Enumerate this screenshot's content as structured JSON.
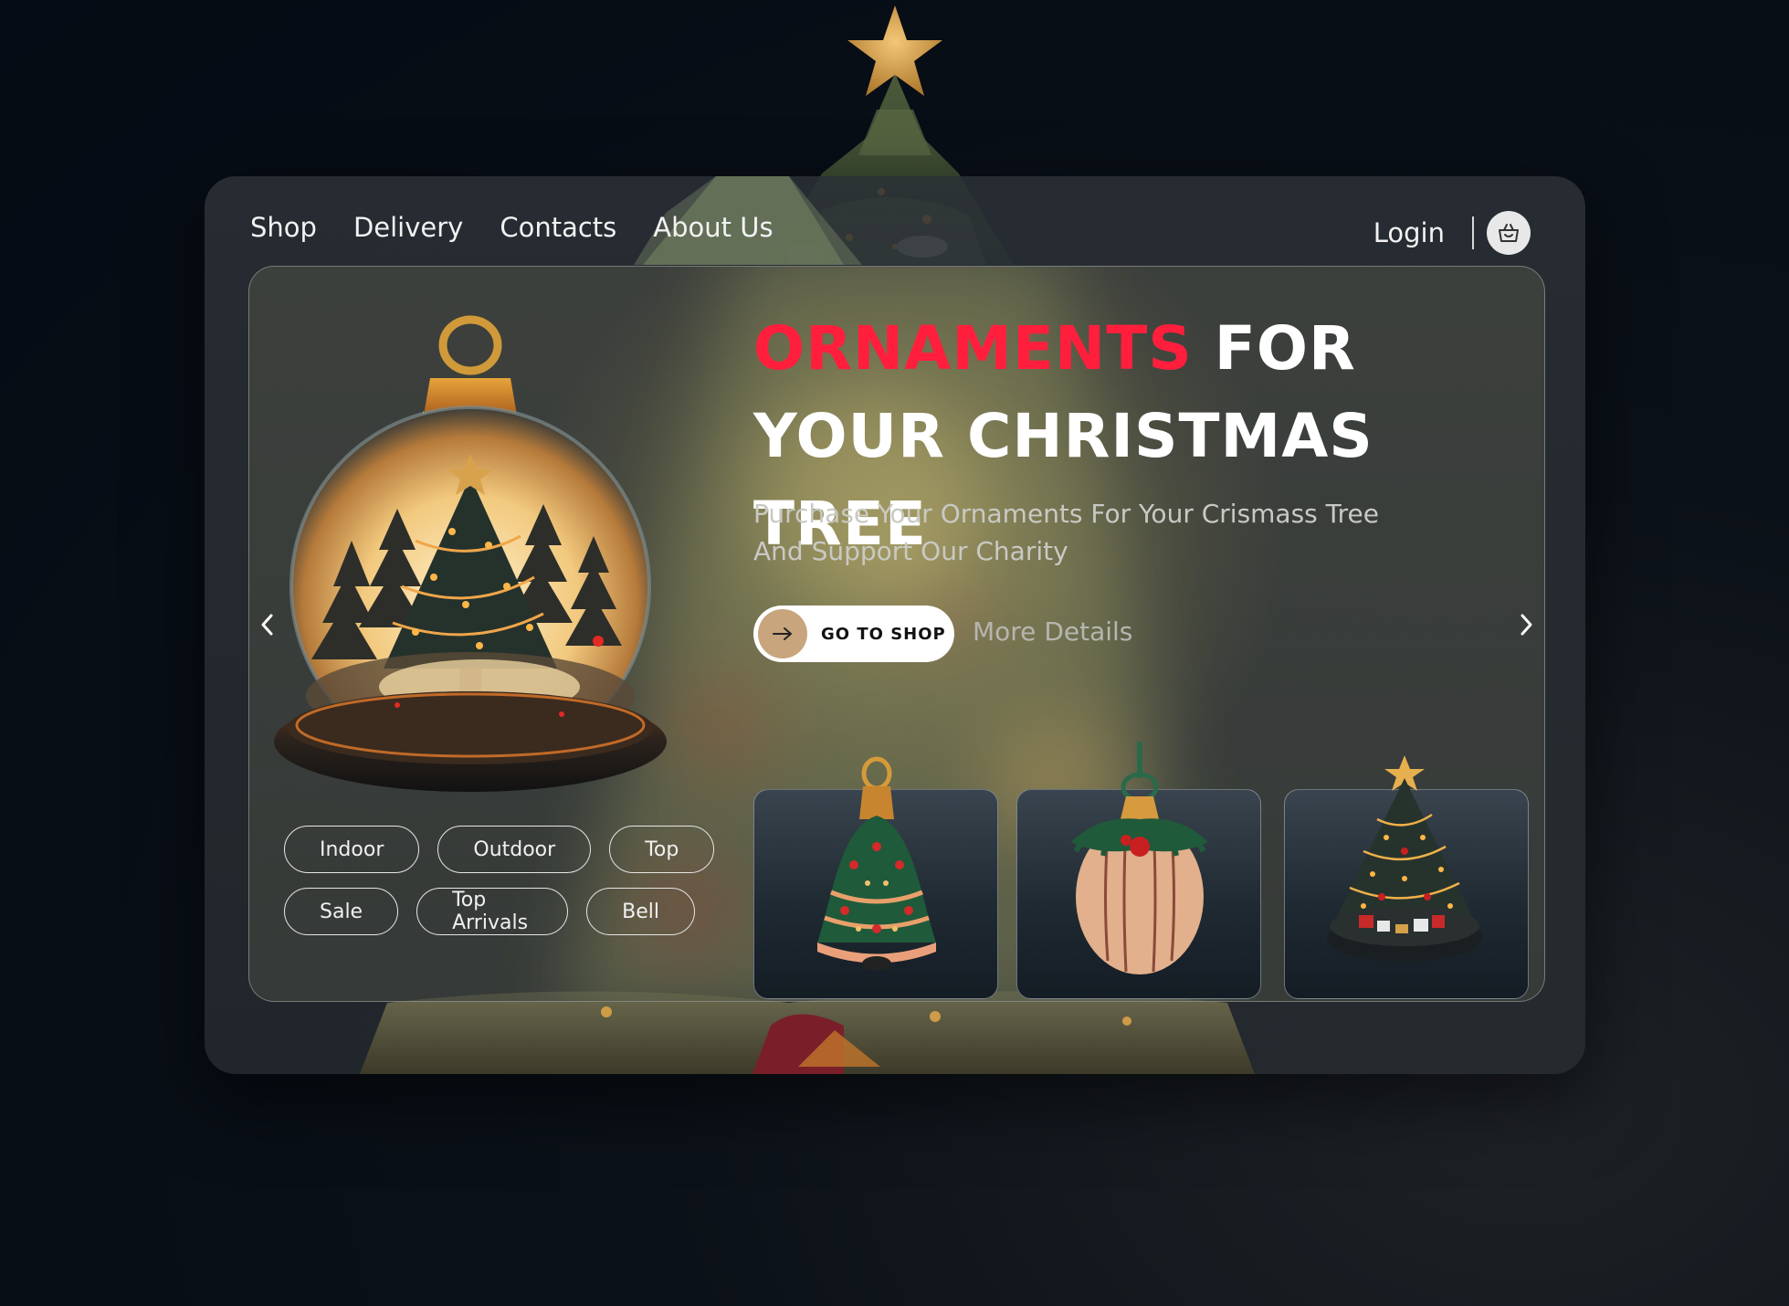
{
  "nav": {
    "links": [
      "Shop",
      "Delivery",
      "Contacts",
      "About Us"
    ],
    "login": "Login"
  },
  "hero": {
    "title_accent": "ORNAMENTS",
    "title_rest_line1": " FOR",
    "title_line2": "YOUR CHRISTMAS TREE",
    "subtitle": "Purchase Your Ornaments For Your Crismass Tree And Support Our Charity",
    "cta_label": "GO TO SHOP",
    "more_label": "More Details"
  },
  "tags": {
    "row1": [
      "Indoor",
      "Outdoor",
      "Top"
    ],
    "row2": [
      "Sale",
      "Top Arrivals",
      "Bell"
    ]
  },
  "products": [
    "bell-ornament",
    "round-ornament",
    "tree-ornament"
  ],
  "colors": {
    "accent_red": "#ff1f3d",
    "cta_circle": "#c8a57d",
    "background": "#050b14"
  }
}
